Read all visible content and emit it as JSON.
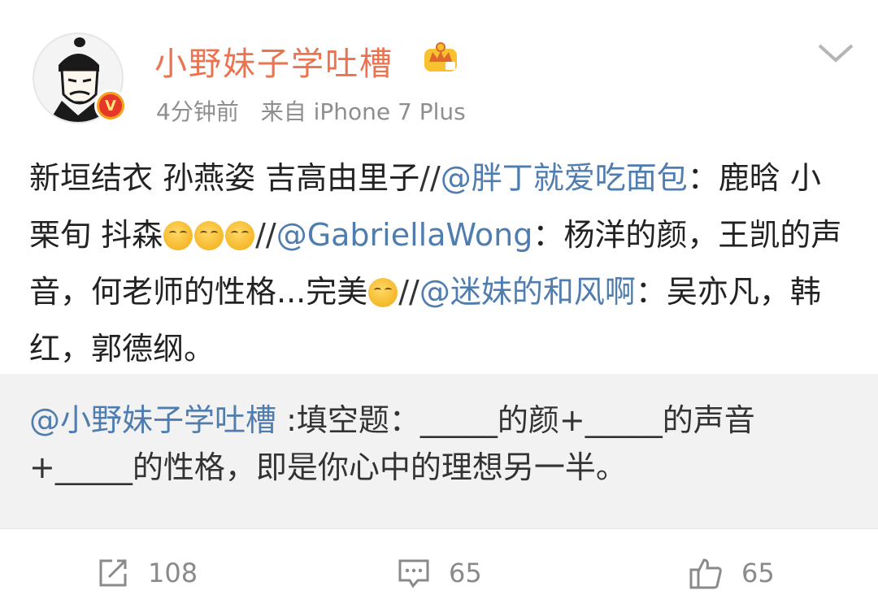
{
  "header": {
    "username": "小野妹子学吐槽",
    "time": "4分钟前",
    "source": "来自 iPhone 7 Plus"
  },
  "post": {
    "t1": "新垣结衣 孙燕姿 吉高由里子",
    "sep1": "//",
    "m1": "@胖丁就爱吃面包",
    "t2": "：鹿晗 小栗旬 抖森",
    "sep2": "//",
    "m2": "@GabriellaWong",
    "t3": "：杨洋的颜，王凯的声音，何老师的性格...完美",
    "sep3": "//",
    "m3": "@迷妹的和风啊",
    "t4": "：吴亦凡，韩红，郭德纲。"
  },
  "repost": {
    "mention": "@小野妹子学吐槽",
    "text": " :填空题：_____的颜+_____的声音+_____的性格，即是你心中的理想另一半。"
  },
  "actions": {
    "repost_count": "108",
    "comment_count": "65",
    "like_count": "65"
  },
  "colors": {
    "username": "#eb7350",
    "mention": "#507daf",
    "meta": "#8e8e8e",
    "repost_bg": "#f2f2f2"
  },
  "icons": {
    "avatar": "samurai-portrait",
    "verified": "verified-v-badge",
    "vip": "crown-vip-icon",
    "menu": "chevron-down-icon",
    "repost": "repost-icon",
    "comment": "comment-icon",
    "like": "thumbs-up-icon"
  }
}
